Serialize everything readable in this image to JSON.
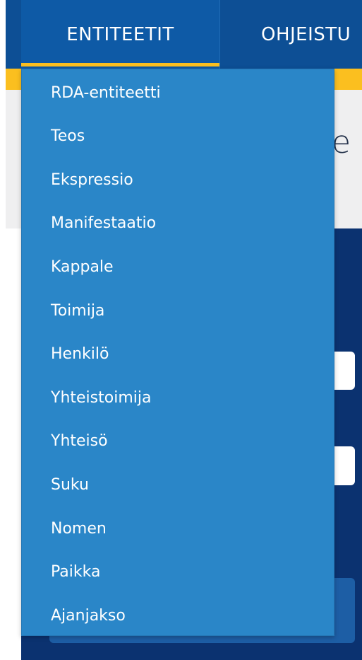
{
  "nav": {
    "tabs": [
      {
        "label": "ENTITEETIT",
        "active": true
      },
      {
        "label": "OHJEISTU",
        "active": false
      }
    ]
  },
  "heading": {
    "partial_text": "e"
  },
  "dropdown": {
    "items": [
      {
        "label": "RDA-entiteetti"
      },
      {
        "label": "Teos"
      },
      {
        "label": "Ekspressio"
      },
      {
        "label": "Manifestaatio"
      },
      {
        "label": "Kappale"
      },
      {
        "label": "Toimija"
      },
      {
        "label": "Henkilö"
      },
      {
        "label": "Yhteistoimija"
      },
      {
        "label": "Yhteisö"
      },
      {
        "label": "Suku"
      },
      {
        "label": "Nomen"
      },
      {
        "label": "Paikka"
      },
      {
        "label": "Ajanjakso"
      }
    ]
  },
  "colors": {
    "nav_bg": "#0d4f95",
    "active_tab_bg": "#0e5aa6",
    "accent_yellow": "#fbbf1f",
    "dropdown_bg": "#2a86c8",
    "panel_bg": "#0b3270"
  }
}
